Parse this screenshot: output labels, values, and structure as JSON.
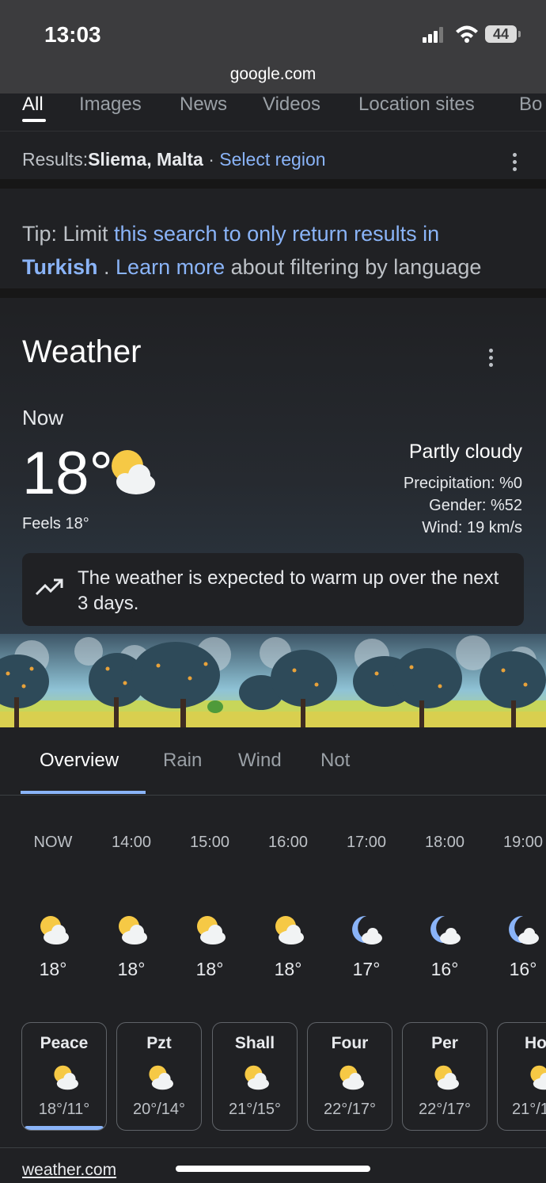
{
  "status_bar": {
    "time": "13:03",
    "battery": "44"
  },
  "browser": {
    "url": "google.com"
  },
  "tabs": [
    "All",
    "Images",
    "News",
    "Videos",
    "Location sites",
    "Bo"
  ],
  "region": {
    "label": "Results:",
    "location": "Sliema, Malta",
    "separator": " · ",
    "select": "Select region"
  },
  "tip": {
    "prefix": "Tip: Limit ",
    "link1": "this search to only return results in",
    "language": "Turkish",
    "middle": " . ",
    "link2": "Learn more",
    "suffix": " about filtering by language"
  },
  "weather": {
    "title": "Weather",
    "now_label": "Now",
    "temperature": "18°",
    "feels": "Feels 18°",
    "condition": "Partly cloudy",
    "precipitation": "Precipitation:  %0",
    "gender": "Gender:  %52",
    "wind": "Wind: 19 km/s",
    "note": "The weather is expected to warm up over the next 3 days.",
    "icon": "partly-cloudy-icon"
  },
  "subtabs": [
    "Overview",
    "Rain",
    "Wind",
    "Not"
  ],
  "hourly": [
    {
      "time": "NOW",
      "temp": "18°",
      "icon": "partly-cloudy"
    },
    {
      "time": "14:00",
      "temp": "18°",
      "icon": "partly-cloudy"
    },
    {
      "time": "15:00",
      "temp": "18°",
      "icon": "partly-cloudy"
    },
    {
      "time": "16:00",
      "temp": "18°",
      "icon": "partly-cloudy"
    },
    {
      "time": "17:00",
      "temp": "17°",
      "icon": "night-cloudy"
    },
    {
      "time": "18:00",
      "temp": "16°",
      "icon": "night-cloudy"
    },
    {
      "time": "19:00",
      "temp": "16°",
      "icon": "night-cloudy"
    }
  ],
  "daily": [
    {
      "name": "Peace",
      "temps": "18°/11°"
    },
    {
      "name": "Pzt",
      "temps": "20°/14°"
    },
    {
      "name": "Shall",
      "temps": "21°/15°"
    },
    {
      "name": "Four",
      "temps": "22°/17°"
    },
    {
      "name": "Per",
      "temps": "22°/17°"
    },
    {
      "name": "Ho",
      "temps": "21°/1"
    }
  ],
  "source": "weather.com",
  "colors": {
    "link": "#8ab4f8",
    "background": "#202124",
    "sun": "#f6c945"
  }
}
